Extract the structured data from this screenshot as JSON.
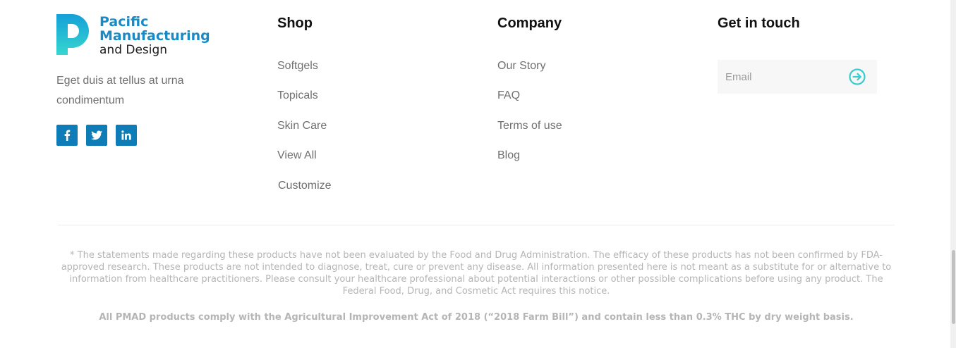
{
  "brand": {
    "line1": "Pacific",
    "line2": "Manufacturing",
    "line3": "and Design",
    "tagline": "Eget duis at tellus at urna condimentum",
    "logo_icon": "p-logo-icon",
    "colors": {
      "brand_blue": "#1b8ac4",
      "logo_gradient_top": "#15a0d8",
      "logo_gradient_bottom": "#36d6d0",
      "social_bg": "#0d7cb7"
    }
  },
  "socials": [
    {
      "icon": "facebook-icon",
      "glyph": "f"
    },
    {
      "icon": "twitter-icon",
      "glyph": "t"
    },
    {
      "icon": "linkedin-icon",
      "glyph": "in"
    }
  ],
  "shop": {
    "heading": "Shop",
    "items": [
      "Softgels",
      "Topicals",
      "Skin Care",
      "View All",
      "Customize"
    ]
  },
  "company": {
    "heading": "Company",
    "items": [
      "Our Story",
      "FAQ",
      "Terms of use",
      "Blog"
    ]
  },
  "contact": {
    "heading": "Get in touch",
    "email_placeholder": "Email",
    "submit_icon": "arrow-right-circle-icon",
    "accent": "#39cbd0"
  },
  "footer": {
    "disclaimer": "* The statements made regarding these products have not been evaluated by the Food and Drug Administration. The efficacy of these products has not been confirmed by FDA-approved research. These products are not intended to diagnose, treat, cure or prevent any disease. All information presented here is not meant as a substitute for or alternative to information from healthcare practitioners. Please consult your healthcare professional about potential interactions or other possible complications before using any product. The Federal Food, Drug, and Cosmetic Act requires this notice.",
    "compliance": "All PMAD products comply with the Agricultural Improvement Act of 2018 (“2018 Farm Bill”) and contain less than 0.3% THC by dry weight basis."
  }
}
